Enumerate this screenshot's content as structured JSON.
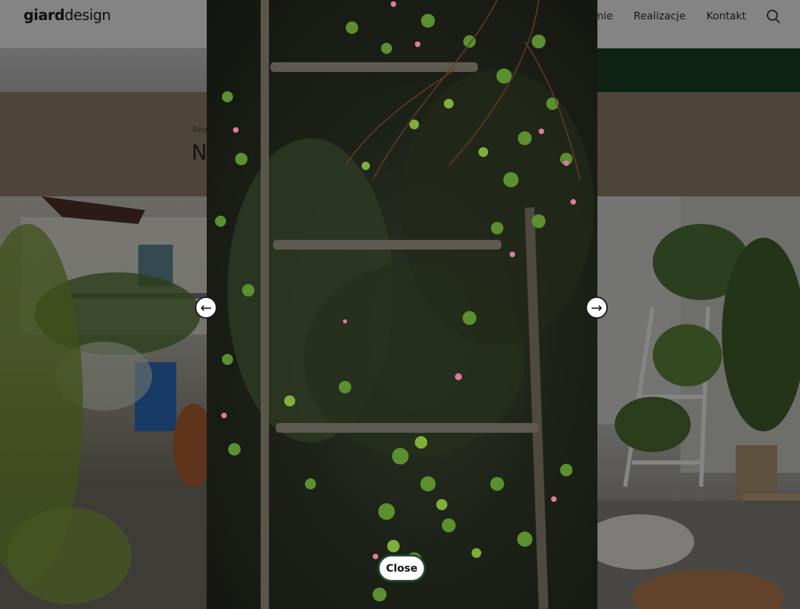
{
  "header": {
    "logo_bold": "giard",
    "logo_light": "design",
    "nav": [
      {
        "label": "firmie"
      },
      {
        "label": "Realizacje"
      },
      {
        "label": "Kontakt"
      }
    ],
    "search_icon": "search-icon"
  },
  "hero": {
    "breadcrumb": "Rea",
    "title": "N"
  },
  "lightbox": {
    "prev_icon": "arrow-left-icon",
    "next_icon": "arrow-right-icon",
    "prev_symbol": "←",
    "next_symbol": "→",
    "close_label": "Close"
  }
}
